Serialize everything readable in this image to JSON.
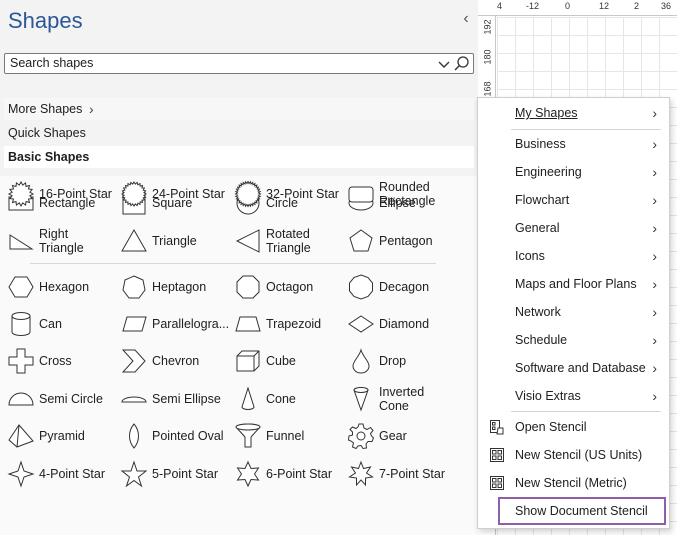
{
  "pane": {
    "title": "Shapes",
    "search_placeholder": "Search shapes",
    "more_shapes": "More Shapes",
    "quick_shapes": "Quick Shapes",
    "basic_shapes": "Basic Shapes"
  },
  "shapes": [
    {
      "label": "Rectangle",
      "icon": "rectangle-icon"
    },
    {
      "label": "Square",
      "icon": "square-icon"
    },
    {
      "label": "Circle",
      "icon": "circle-icon"
    },
    {
      "label": "Ellipse",
      "icon": "ellipse-icon"
    },
    {
      "label": "Right Triangle",
      "icon": "right-triangle-icon"
    },
    {
      "label": "Triangle",
      "icon": "triangle-icon"
    },
    {
      "label": "Rotated Triangle",
      "icon": "rotated-triangle-icon"
    },
    {
      "label": "Pentagon",
      "icon": "pentagon-icon"
    },
    {
      "label": "Hexagon",
      "icon": "hexagon-icon"
    },
    {
      "label": "Heptagon",
      "icon": "heptagon-icon"
    },
    {
      "label": "Octagon",
      "icon": "octagon-icon"
    },
    {
      "label": "Decagon",
      "icon": "decagon-icon"
    },
    {
      "label": "Can",
      "icon": "can-icon"
    },
    {
      "label": "Parallelogra...",
      "icon": "parallelogram-icon"
    },
    {
      "label": "Trapezoid",
      "icon": "trapezoid-icon"
    },
    {
      "label": "Diamond",
      "icon": "diamond-icon"
    },
    {
      "label": "Cross",
      "icon": "cross-icon"
    },
    {
      "label": "Chevron",
      "icon": "chevron-icon"
    },
    {
      "label": "Cube",
      "icon": "cube-icon"
    },
    {
      "label": "Drop",
      "icon": "drop-icon"
    },
    {
      "label": "Semi Circle",
      "icon": "semi-circle-icon"
    },
    {
      "label": "Semi Ellipse",
      "icon": "semi-ellipse-icon"
    },
    {
      "label": "Cone",
      "icon": "cone-icon"
    },
    {
      "label": "Inverted Cone",
      "icon": "inverted-cone-icon"
    },
    {
      "label": "Pyramid",
      "icon": "pyramid-icon"
    },
    {
      "label": "Pointed Oval",
      "icon": "pointed-oval-icon"
    },
    {
      "label": "Funnel",
      "icon": "funnel-icon"
    },
    {
      "label": "Gear",
      "icon": "gear-icon"
    },
    {
      "label": "4-Point Star",
      "icon": "four-point-star-icon"
    },
    {
      "label": "5-Point Star",
      "icon": "five-point-star-icon"
    },
    {
      "label": "6-Point Star",
      "icon": "six-point-star-icon"
    },
    {
      "label": "7-Point Star",
      "icon": "seven-point-star-icon"
    },
    {
      "label": "16-Point Star",
      "icon": "sixteen-point-star-icon"
    },
    {
      "label": "24-Point Star",
      "icon": "twentyfour-point-star-icon"
    },
    {
      "label": "32-Point Star",
      "icon": "thirtytwo-point-star-icon"
    },
    {
      "label": "Rounded Rectangle",
      "icon": "rounded-rectangle-icon"
    }
  ],
  "ruler": {
    "top_labels": [
      "4",
      "-12",
      "0",
      "12",
      "2",
      "36"
    ],
    "left_labels": [
      "192",
      "180",
      "168"
    ]
  },
  "menu": {
    "my_shapes": "My Shapes",
    "categories": [
      "Business",
      "Engineering",
      "Flowchart",
      "General",
      "Icons",
      "Maps and Floor Plans",
      "Network",
      "Schedule",
      "Software and Database",
      "Visio Extras"
    ],
    "open_stencil": "Open Stencil",
    "new_stencil_us": "New Stencil (US Units)",
    "new_stencil_metric": "New Stencil (Metric)",
    "show_document_stencil": "Show Document Stencil"
  },
  "colors": {
    "title": "#2b5797",
    "highlight_border": "#8e5ea8"
  }
}
